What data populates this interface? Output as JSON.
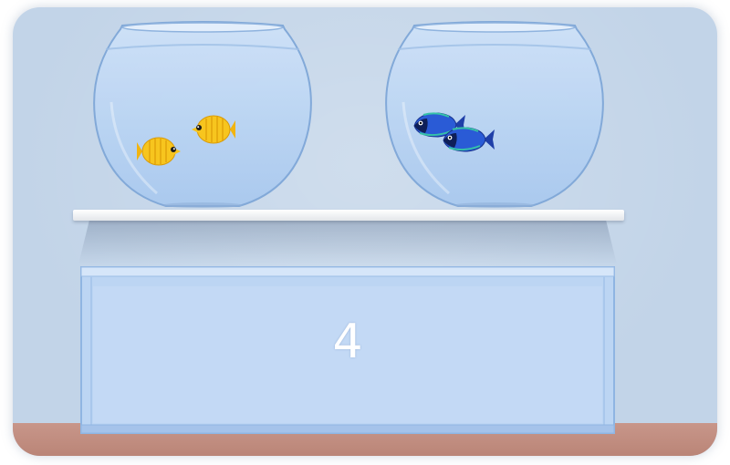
{
  "scene": {
    "bowls": [
      {
        "id": "left",
        "fish_type": "yellow butterflyfish",
        "fish_count": 2
      },
      {
        "id": "right",
        "fish_type": "blue surgeonfish",
        "fish_count": 2
      }
    ],
    "tank": {
      "number": "4"
    }
  },
  "colors": {
    "wall": "#c2d4e8",
    "floor": "#ba8577",
    "shelf": "#f2f4f6",
    "water": "#b9d6f5",
    "yellow_fish": "#f5c21b",
    "blue_fish": "#2a5bd6"
  }
}
